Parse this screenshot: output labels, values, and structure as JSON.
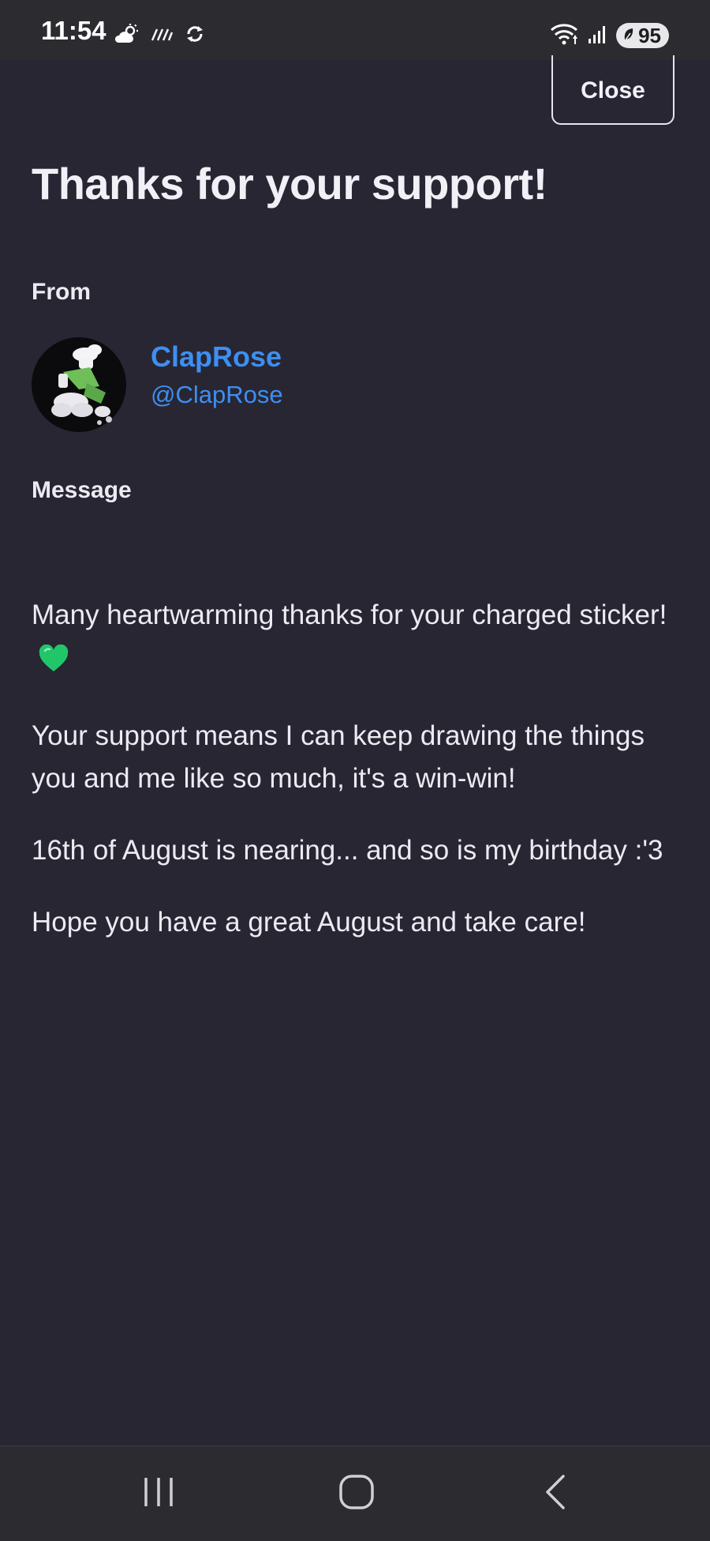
{
  "status_bar": {
    "time": "11:54",
    "battery": "95",
    "icons_left": [
      "cloud-sun-icon",
      "haze-icon",
      "sync-icon"
    ],
    "icons_right": [
      "wifi-icon",
      "signal-icon",
      "battery-saver-icon"
    ]
  },
  "dialog": {
    "close_label": "Close",
    "title": "Thanks for your support!",
    "from_label": "From",
    "author": {
      "name": "ClapRose",
      "handle": "@ClapRose"
    },
    "message_label": "Message",
    "message_paragraphs": [
      "Many heartwarming thanks for your charged sticker!",
      "Your support means I can keep drawing the things you and me like so much, it's a win-win!",
      "16th of August is nearing... and so is my birthday :'3",
      "Hope you have a great August and take care!"
    ]
  },
  "nav_bar": {
    "buttons": [
      "recent-apps",
      "home",
      "back"
    ]
  },
  "colors": {
    "background": "#282633",
    "accent_link": "#3d8ff2",
    "heart": "#22c66a",
    "bars": "#2b2b30"
  }
}
